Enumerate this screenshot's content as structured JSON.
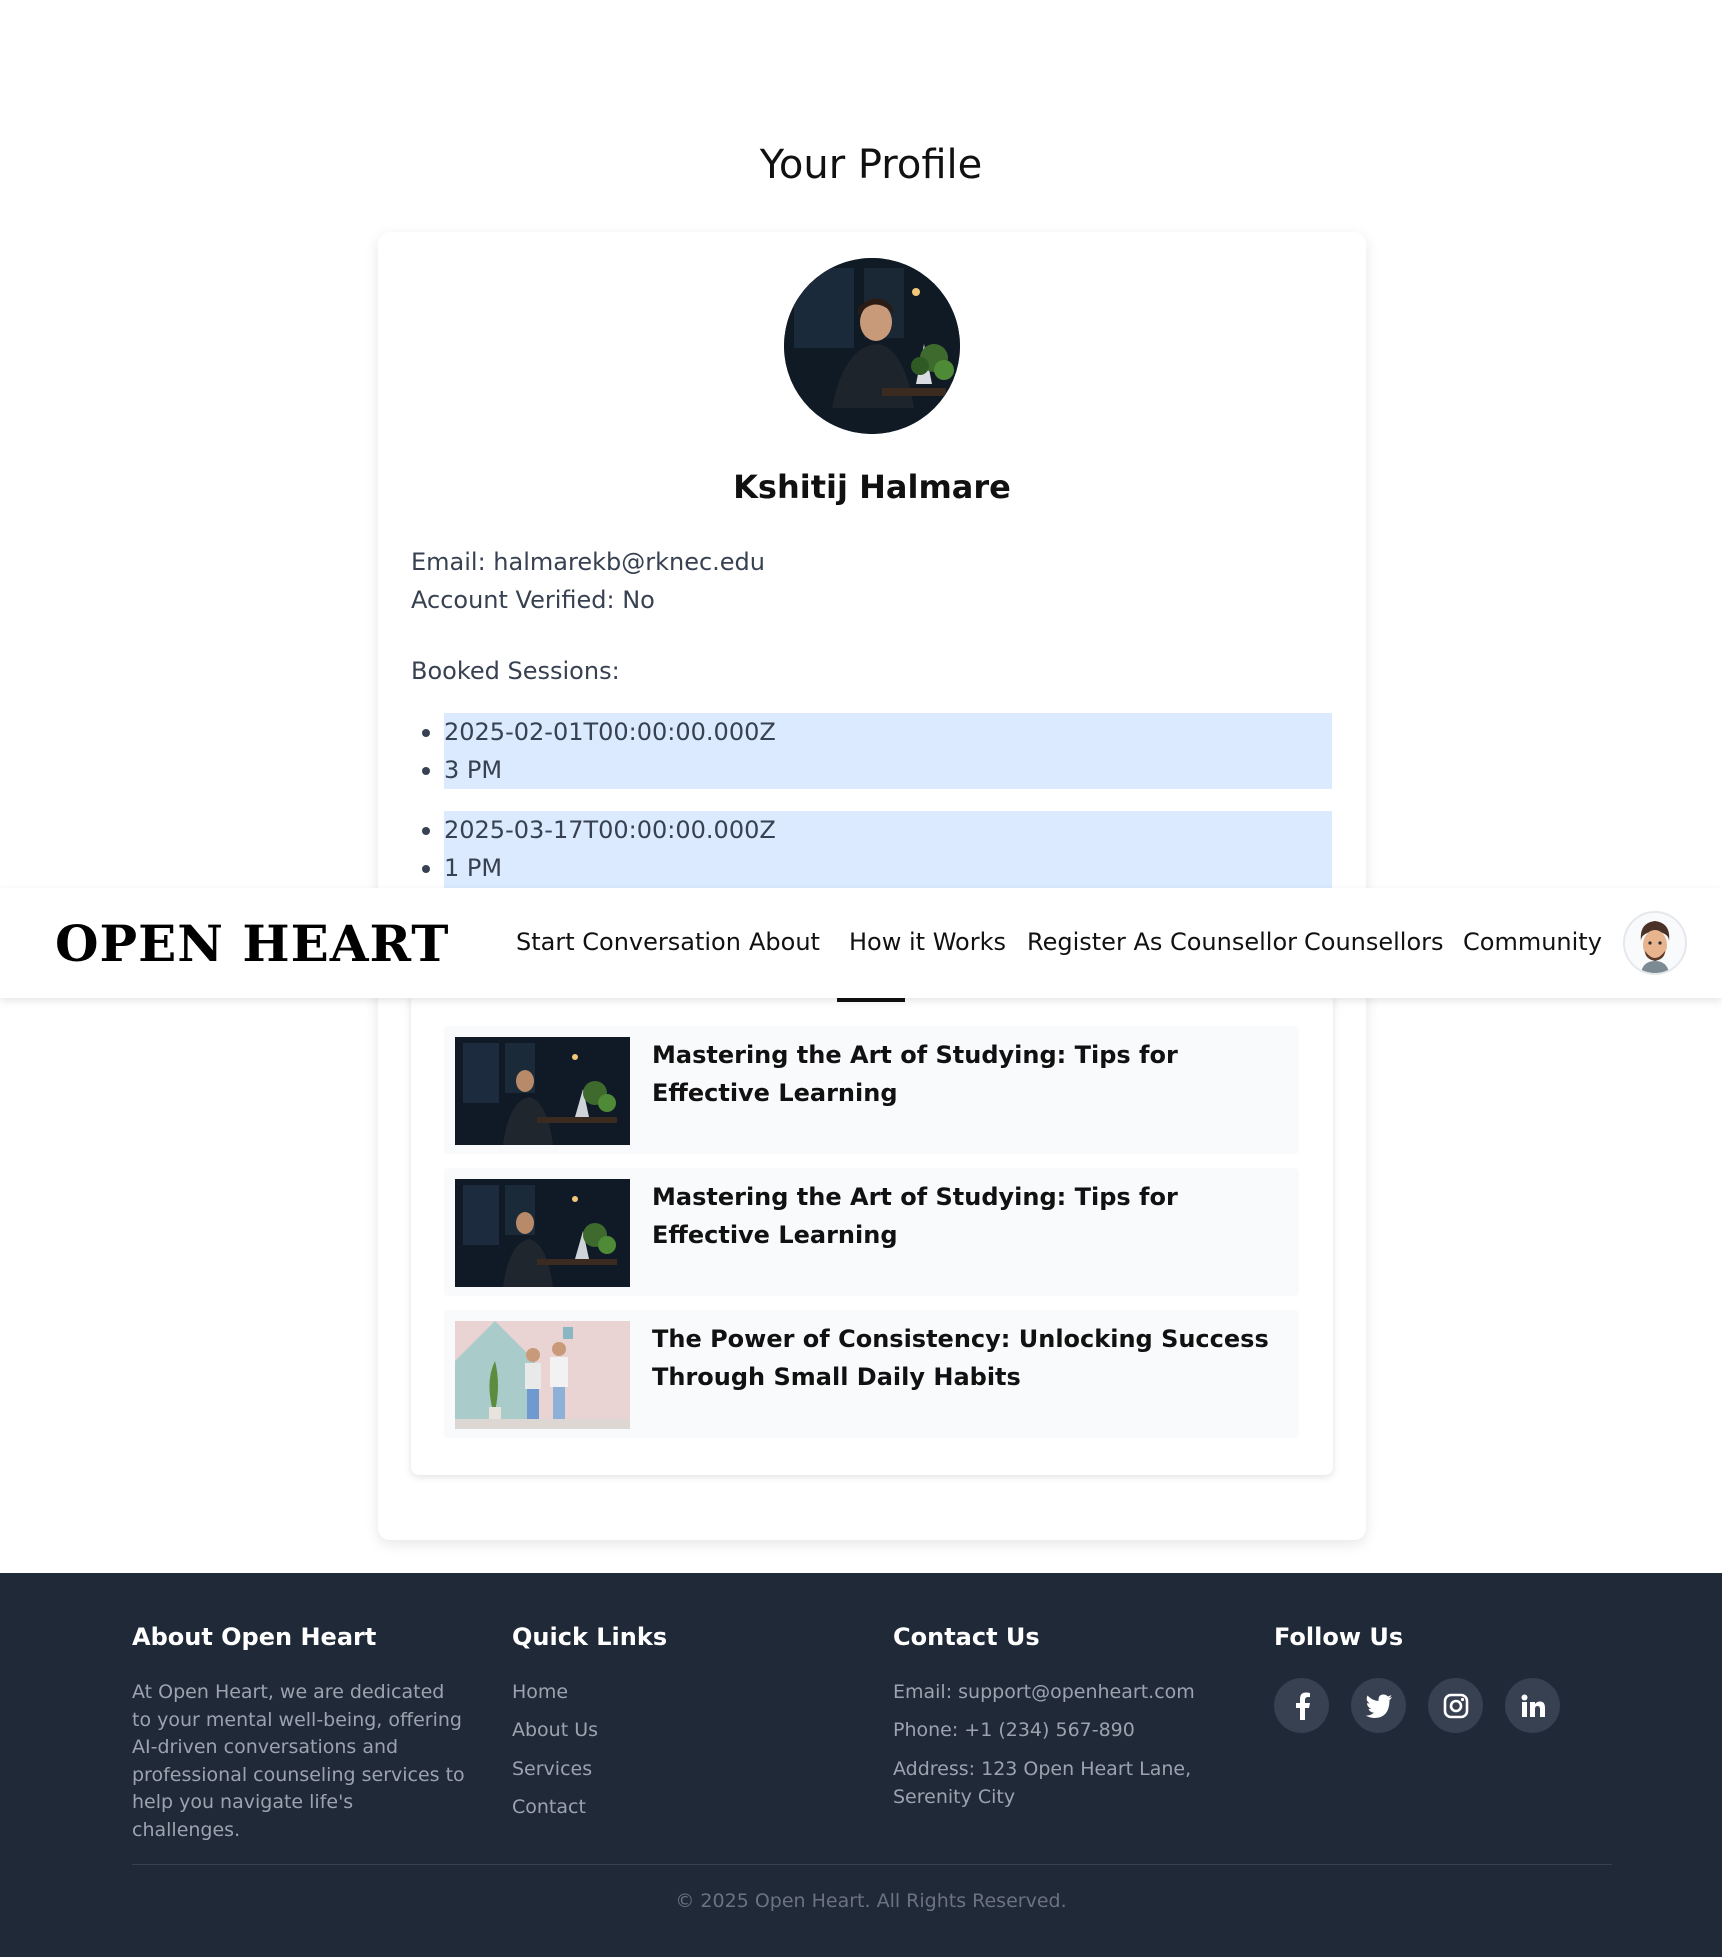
{
  "page": {
    "title": "Your Profile"
  },
  "profile": {
    "name": "Kshitij Halmare",
    "email_line": "Email: halmarekb@rknec.edu",
    "verified_line": "Account Verified: No",
    "sessions_label": "Booked Sessions:",
    "sessions": [
      {
        "date": "2025-02-01T00:00:00.000Z",
        "time": "3 PM"
      },
      {
        "date": "2025-03-17T00:00:00.000Z",
        "time": "1 PM"
      }
    ]
  },
  "blogs": [
    {
      "title": "Mastering the Art of Studying: Tips for Effective Learning",
      "thumb": "night-study-image"
    },
    {
      "title": "Mastering the Art of Studying: Tips for Effective Learning",
      "thumb": "night-study-image"
    },
    {
      "title": "The Power of Consistency: Unlocking Success Through Small Daily Habits",
      "thumb": "couple-portrait-image"
    }
  ],
  "navbar": {
    "brand": "OPEN HEART",
    "links": [
      "Start Conversation",
      "About",
      "How it Works",
      "Register As Counsellor",
      "Counsellors",
      "Community"
    ],
    "avatar_icon": "user-avatar-icon"
  },
  "footer": {
    "about": {
      "heading": "About Open Heart",
      "text": "At Open Heart, we are dedicated to your mental well-being, offering AI-driven conversations and professional counseling services to help you navigate life's challenges."
    },
    "quick_links": {
      "heading": "Quick Links",
      "links": [
        "Home",
        "About Us",
        "Services",
        "Contact"
      ]
    },
    "contact": {
      "heading": "Contact Us",
      "email": "Email: support@openheart.com",
      "phone": "Phone: +1 (234) 567-890",
      "address": "Address: 123 Open Heart Lane, Serenity City"
    },
    "follow": {
      "heading": "Follow Us",
      "icons": [
        "facebook-icon",
        "twitter-icon",
        "instagram-icon",
        "linkedin-icon"
      ]
    },
    "copyright": "© 2025 Open Heart. All Rights Reserved."
  },
  "colors": {
    "session_highlight": "#dbeafe",
    "footer_bg": "#1f2937",
    "footer_text": "#9ca3af"
  }
}
